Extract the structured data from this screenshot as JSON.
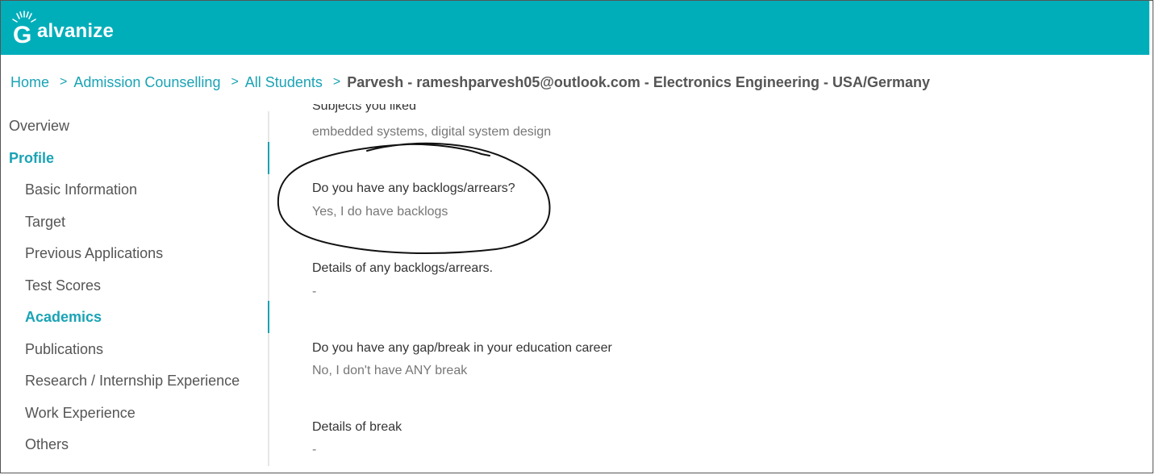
{
  "header": {
    "logo_text": "alvanize",
    "logo_letter": "G",
    "brand_color": "#00aeba"
  },
  "breadcrumb": {
    "items": [
      "Home",
      "Admission Counselling",
      "All Students"
    ],
    "current": "Parvesh - rameshparvesh05@outlook.com - Electronics Engineering - USA/Germany",
    "separator": ">"
  },
  "sidebar": {
    "items": [
      {
        "label": "Overview",
        "level": 1,
        "active": false
      },
      {
        "label": "Profile",
        "level": 1,
        "active": true
      },
      {
        "label": "Basic Information",
        "level": 2,
        "active": false
      },
      {
        "label": "Target",
        "level": 2,
        "active": false
      },
      {
        "label": "Previous Applications",
        "level": 2,
        "active": false
      },
      {
        "label": "Test Scores",
        "level": 2,
        "active": false
      },
      {
        "label": "Academics",
        "level": 2,
        "active": true
      },
      {
        "label": "Publications",
        "level": 2,
        "active": false
      },
      {
        "label": "Research / Internship Experience",
        "level": 2,
        "active": false
      },
      {
        "label": "Work Experience",
        "level": 2,
        "active": false
      },
      {
        "label": "Others",
        "level": 2,
        "active": false
      }
    ],
    "accent_color": "#1aa3b5"
  },
  "content": {
    "fields": [
      {
        "label": "Subjects you liked",
        "value": "embedded systems, digital system design"
      },
      {
        "label": "Do you have any backlogs/arrears?",
        "value": "Yes, I do have backlogs"
      },
      {
        "label": "Details of any backlogs/arrears.",
        "value": "-"
      },
      {
        "label": "Do you have any gap/break in your education career",
        "value": "No, I don't have ANY break"
      },
      {
        "label": "Details of break",
        "value": "-"
      }
    ]
  }
}
